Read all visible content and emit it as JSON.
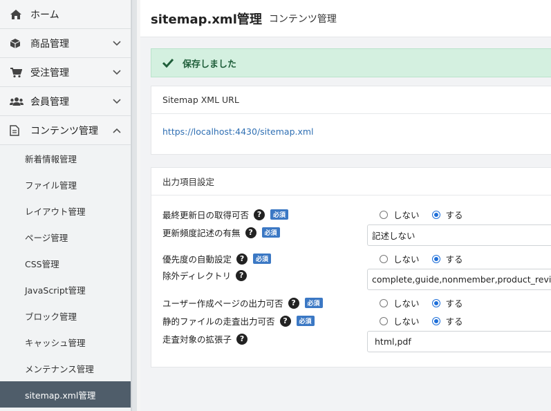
{
  "sidebar": {
    "items": [
      {
        "label": "ホーム",
        "icon": "home-icon"
      },
      {
        "label": "商品管理",
        "icon": "box-icon"
      },
      {
        "label": "受注管理",
        "icon": "cart-icon"
      },
      {
        "label": "会員管理",
        "icon": "users-icon"
      },
      {
        "label": "コンテンツ管理",
        "icon": "document-icon"
      }
    ],
    "sub_items": [
      "新着情報管理",
      "ファイル管理",
      "レイアウト管理",
      "ページ管理",
      "CSS管理",
      "JavaScript管理",
      "ブロック管理",
      "キャッシュ管理",
      "メンテナンス管理",
      "sitemap.xml管理"
    ]
  },
  "header": {
    "title": "sitemap.xml管理",
    "subtitle": "コンテンツ管理"
  },
  "alert": {
    "text": "保存しました",
    "color": "#d4f0e0"
  },
  "card_url": {
    "heading": "Sitemap XML URL",
    "url": "https://localhost:4430/sitemap.xml"
  },
  "settings": {
    "heading": "出力項目設定",
    "required_label": "必須",
    "help_glyph": "?",
    "radio_no": "しない",
    "radio_yes": "する",
    "last_modified": {
      "label": "最終更新日の取得可否",
      "selected": "する"
    },
    "changefreq": {
      "label": "更新頻度記述の有無",
      "value": "記述しない"
    },
    "priority": {
      "label": "優先度の自動設定",
      "selected": "する"
    },
    "exclude_dirs": {
      "label": "除外ディレクトリ",
      "value": "complete,guide,nonmember,product_review"
    },
    "user_pages": {
      "label": "ユーザー作成ページの出力可否",
      "selected": "する"
    },
    "static_files": {
      "label": "静的ファイルの走査出力可否",
      "selected": "する"
    },
    "extensions": {
      "label": "走査対象の拡張子",
      "value": "html,pdf"
    }
  }
}
